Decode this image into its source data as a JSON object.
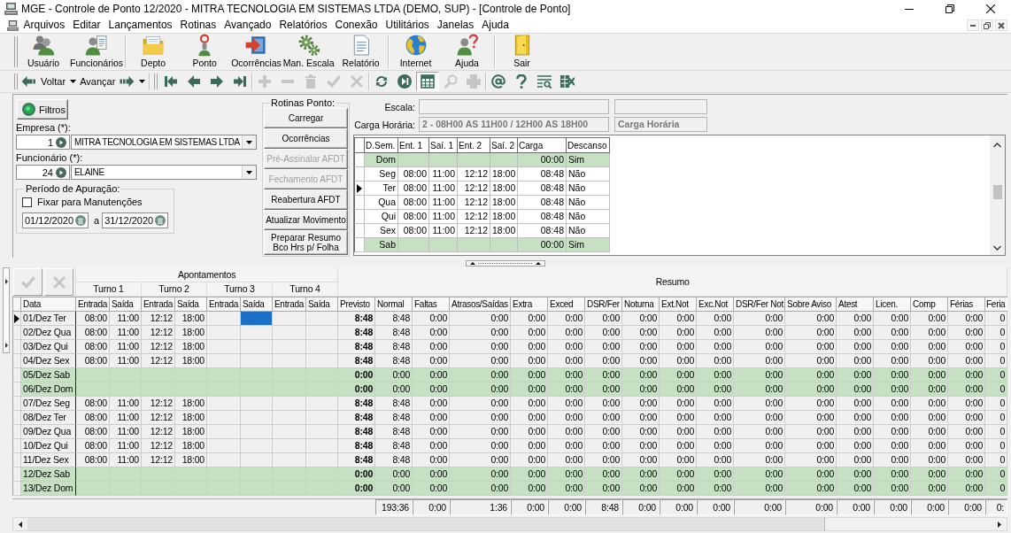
{
  "window": {
    "title": "MGE - Controle de Ponto 12/2020 - MITRA TECNOLOGIA EM SISTEMAS LTDA (DEMO, SUP) - [Controle de Ponto]"
  },
  "menu": [
    "Arquivos",
    "Editar",
    "Lançamentos",
    "Rotinas",
    "Avançado",
    "Relatórios",
    "Conexão",
    "Utilitários",
    "Janelas",
    "Ajuda"
  ],
  "toolbar": [
    [
      {
        "label": "Usuário"
      },
      {
        "label": "Funcionários"
      }
    ],
    [
      {
        "label": "Depto"
      },
      {
        "label": "Ponto"
      },
      {
        "label": "Ocorrências"
      },
      {
        "label": "Man. Escala"
      },
      {
        "label": "Relatório"
      }
    ],
    [
      {
        "label": "Internet"
      },
      {
        "label": "Ajuda"
      }
    ],
    [
      {
        "label": "Sair"
      }
    ]
  ],
  "navigation": {
    "back": "Voltar",
    "forward": "Avançar"
  },
  "tool_groups": [
    [
      {
        "disabled": false,
        "pressed": false
      },
      {
        "disabled": false,
        "pressed": false
      },
      {
        "disabled": false,
        "pressed": false
      },
      {
        "disabled": false,
        "pressed": false
      }
    ],
    [
      {
        "disabled": true,
        "pressed": false
      },
      {
        "disabled": true,
        "pressed": false
      },
      {
        "disabled": true,
        "pressed": false
      },
      {
        "disabled": true,
        "pressed": false
      },
      {
        "disabled": true,
        "pressed": false
      }
    ],
    [
      {
        "disabled": false,
        "pressed": false
      },
      {
        "disabled": false,
        "pressed": false
      },
      {
        "disabled": false,
        "pressed": true
      },
      {
        "disabled": true,
        "pressed": false
      },
      {
        "disabled": true,
        "pressed": false
      }
    ],
    [
      {
        "disabled": false,
        "pressed": false
      },
      {
        "disabled": false,
        "pressed": false
      },
      {
        "disabled": false,
        "pressed": false
      },
      {
        "disabled": false,
        "pressed": false
      }
    ]
  ],
  "filters": {
    "button": "Filtros",
    "company": {
      "label": "Empresa (*):",
      "code": "1",
      "name": "MITRA TECNOLOGIA EM SISTEMAS LTDA"
    },
    "employee": {
      "label": "Funcionário (*):",
      "code": "24",
      "name": "ELAINE"
    },
    "period": {
      "title": "Período de Apuração:",
      "fixed": {
        "label": "Fixar para Manutenções",
        "checked": false
      },
      "start": "01/12/2020",
      "to": "a",
      "end": "31/12/2020"
    }
  },
  "routines": {
    "title": "Rotinas Ponto:",
    "buttons": [
      {
        "label": "Carregar",
        "disabled": false
      },
      {
        "label": "Ocorrências",
        "disabled": false
      },
      {
        "label": "Pré-Assinalar AFDT",
        "disabled": true
      },
      {
        "label": "Fechamento AFDT",
        "disabled": true
      },
      {
        "label": "Reabertura AFDT",
        "disabled": false
      },
      {
        "label": "Atualizar Movimento",
        "disabled": false
      },
      {
        "label": "Preparar Resumo Bco Hrs p/ Folha",
        "disabled": false
      }
    ]
  },
  "schedule": {
    "scale_label": "Escala:",
    "workload_label": "Carga Horária:",
    "workload": "2 - 08H00 AS 11H00 / 12H00 AS 18H00",
    "workload_caption": "Carga Horária",
    "columns": [
      "D.Sem.",
      "Ent. 1",
      "Saí. 1",
      "Ent. 2",
      "Saí. 2",
      "Carga",
      "Descanso"
    ],
    "rows": [
      {
        "day": "Dom",
        "load": "00:00",
        "rest": "Sim",
        "rest_day": true,
        "selected": false
      },
      {
        "day": "Seg",
        "times": [
          "08:00",
          "11:00",
          "12:12",
          "18:00"
        ],
        "load": "08:48",
        "rest": "Não",
        "rest_day": false,
        "selected": false
      },
      {
        "day": "Ter",
        "times": [
          "08:00",
          "11:00",
          "12:12",
          "18:00"
        ],
        "load": "08:48",
        "rest": "Não",
        "rest_day": false,
        "selected": true
      },
      {
        "day": "Qua",
        "times": [
          "08:00",
          "11:00",
          "12:12",
          "18:00"
        ],
        "load": "08:48",
        "rest": "Não",
        "rest_day": false,
        "selected": false
      },
      {
        "day": "Qui",
        "times": [
          "08:00",
          "11:00",
          "12:12",
          "18:00"
        ],
        "load": "08:48",
        "rest": "Não",
        "rest_day": false,
        "selected": false
      },
      {
        "day": "Sex",
        "times": [
          "08:00",
          "11:00",
          "12:12",
          "18:00"
        ],
        "load": "08:48",
        "rest": "Não",
        "rest_day": false,
        "selected": false
      },
      {
        "day": "Sab",
        "load": "00:00",
        "rest": "Sim",
        "rest_day": true,
        "selected": false
      }
    ]
  },
  "grid": {
    "actions": [
      {
        "disabled": true
      },
      {
        "disabled": true
      }
    ],
    "group_title": "Apontamentos",
    "shifts": [
      "Turno 1",
      "Turno 2",
      "Turno 3",
      "Turno 4"
    ],
    "summary_title": "Resumo",
    "columns": [
      {
        "label": "Data",
        "selected": false
      },
      {
        "label": "Entrada",
        "selected": false
      },
      {
        "label": "Saída",
        "selected": false
      },
      {
        "label": "Entrada",
        "selected": false
      },
      {
        "label": "Saída",
        "selected": false
      },
      {
        "label": "Entrada",
        "selected": false
      },
      {
        "label": "Saída",
        "selected": true
      },
      {
        "label": "Entrada",
        "selected": false
      },
      {
        "label": "Saída",
        "selected": false
      },
      {
        "label": "Previsto",
        "selected": false
      },
      {
        "label": "Normal",
        "selected": false
      },
      {
        "label": "Faltas",
        "selected": false
      },
      {
        "label": "Atrasos/Saídas",
        "selected": false
      },
      {
        "label": "Extra",
        "selected": false
      },
      {
        "label": "Exced",
        "selected": false
      },
      {
        "label": "DSR/Fer",
        "selected": false
      },
      {
        "label": "Noturna",
        "selected": false
      },
      {
        "label": "Ext.Not",
        "selected": false
      },
      {
        "label": "Exc.Not",
        "selected": false
      },
      {
        "label": "DSR/Fer Not",
        "selected": false
      },
      {
        "label": "Sobre Aviso",
        "selected": false
      },
      {
        "label": "Atest",
        "selected": false
      },
      {
        "label": "Licen.",
        "selected": false
      },
      {
        "label": "Comp",
        "selected": false
      },
      {
        "label": "Férias",
        "selected": false
      },
      {
        "label": "Feria",
        "selected": false
      }
    ],
    "rows": [
      {
        "date": "01/Dez Ter",
        "punches": [
          "08:00",
          "11:00",
          "12:12",
          "18:00"
        ],
        "summary": [
          "8:48",
          "8:48",
          "0:00",
          "0:00",
          "0:00",
          "0:00",
          "0:00",
          "0:00",
          "0:00",
          "0:00",
          "0:00",
          "0:00",
          "0:00",
          "0:00",
          "0:00",
          "0:00",
          "0"
        ],
        "rest_day": false,
        "selected": true
      },
      {
        "date": "02/Dez Qua",
        "punches": [
          "08:00",
          "11:00",
          "12:12",
          "18:00"
        ],
        "summary": [
          "8:48",
          "8:48",
          "0:00",
          "0:00",
          "0:00",
          "0:00",
          "0:00",
          "0:00",
          "0:00",
          "0:00",
          "0:00",
          "0:00",
          "0:00",
          "0:00",
          "0:00",
          "0:00",
          "0"
        ],
        "rest_day": false,
        "selected": false
      },
      {
        "date": "03/Dez Qui",
        "punches": [
          "08:00",
          "11:00",
          "12:12",
          "18:00"
        ],
        "summary": [
          "8:48",
          "8:48",
          "0:00",
          "0:00",
          "0:00",
          "0:00",
          "0:00",
          "0:00",
          "0:00",
          "0:00",
          "0:00",
          "0:00",
          "0:00",
          "0:00",
          "0:00",
          "0:00",
          "0"
        ],
        "rest_day": false,
        "selected": false
      },
      {
        "date": "04/Dez Sex",
        "punches": [
          "08:00",
          "11:00",
          "12:12",
          "18:00"
        ],
        "summary": [
          "8:48",
          "8:48",
          "0:00",
          "0:00",
          "0:00",
          "0:00",
          "0:00",
          "0:00",
          "0:00",
          "0:00",
          "0:00",
          "0:00",
          "0:00",
          "0:00",
          "0:00",
          "0:00",
          "0"
        ],
        "rest_day": false,
        "selected": false
      },
      {
        "date": "05/Dez Sab",
        "summary": [
          "0:00",
          "0:00",
          "0:00",
          "0:00",
          "0:00",
          "0:00",
          "0:00",
          "0:00",
          "0:00",
          "0:00",
          "0:00",
          "0:00",
          "0:00",
          "0:00",
          "0:00",
          "0:00",
          "0"
        ],
        "rest_day": true,
        "selected": false
      },
      {
        "date": "06/Dez Dom",
        "summary": [
          "0:00",
          "0:00",
          "0:00",
          "0:00",
          "0:00",
          "0:00",
          "0:00",
          "0:00",
          "0:00",
          "0:00",
          "0:00",
          "0:00",
          "0:00",
          "0:00",
          "0:00",
          "0:00",
          "0"
        ],
        "rest_day": true,
        "selected": false
      },
      {
        "date": "07/Dez Seg",
        "punches": [
          "08:00",
          "11:00",
          "12:12",
          "18:00"
        ],
        "summary": [
          "8:48",
          "8:48",
          "0:00",
          "0:00",
          "0:00",
          "0:00",
          "0:00",
          "0:00",
          "0:00",
          "0:00",
          "0:00",
          "0:00",
          "0:00",
          "0:00",
          "0:00",
          "0:00",
          "0"
        ],
        "rest_day": false,
        "selected": false
      },
      {
        "date": "08/Dez Ter",
        "punches": [
          "08:00",
          "11:00",
          "12:12",
          "18:00"
        ],
        "summary": [
          "8:48",
          "8:48",
          "0:00",
          "0:00",
          "0:00",
          "0:00",
          "0:00",
          "0:00",
          "0:00",
          "0:00",
          "0:00",
          "0:00",
          "0:00",
          "0:00",
          "0:00",
          "0:00",
          "0"
        ],
        "rest_day": false,
        "selected": false
      },
      {
        "date": "09/Dez Qua",
        "punches": [
          "08:00",
          "11:00",
          "12:12",
          "18:00"
        ],
        "summary": [
          "8:48",
          "8:48",
          "0:00",
          "0:00",
          "0:00",
          "0:00",
          "0:00",
          "0:00",
          "0:00",
          "0:00",
          "0:00",
          "0:00",
          "0:00",
          "0:00",
          "0:00",
          "0:00",
          "0"
        ],
        "rest_day": false,
        "selected": false
      },
      {
        "date": "10/Dez Qui",
        "punches": [
          "08:00",
          "11:00",
          "12:12",
          "18:00"
        ],
        "summary": [
          "8:48",
          "8:48",
          "0:00",
          "0:00",
          "0:00",
          "0:00",
          "0:00",
          "0:00",
          "0:00",
          "0:00",
          "0:00",
          "0:00",
          "0:00",
          "0:00",
          "0:00",
          "0:00",
          "0"
        ],
        "rest_day": false,
        "selected": false
      },
      {
        "date": "11/Dez Sex",
        "punches": [
          "08:00",
          "11:00",
          "12:12",
          "18:00"
        ],
        "summary": [
          "8:48",
          "8:48",
          "0:00",
          "0:00",
          "0:00",
          "0:00",
          "0:00",
          "0:00",
          "0:00",
          "0:00",
          "0:00",
          "0:00",
          "0:00",
          "0:00",
          "0:00",
          "0:00",
          "0"
        ],
        "rest_day": false,
        "selected": false
      },
      {
        "date": "12/Dez Sab",
        "summary": [
          "0:00",
          "0:00",
          "0:00",
          "0:00",
          "0:00",
          "0:00",
          "0:00",
          "0:00",
          "0:00",
          "0:00",
          "0:00",
          "0:00",
          "0:00",
          "0:00",
          "0:00",
          "0:00",
          "0"
        ],
        "rest_day": true,
        "selected": false
      },
      {
        "date": "13/Dez Dom",
        "summary": [
          "0:00",
          "0:00",
          "0:00",
          "0:00",
          "0:00",
          "0:00",
          "0:00",
          "0:00",
          "0:00",
          "0:00",
          "0:00",
          "0:00",
          "0:00",
          "0:00",
          "0:00",
          "0:00",
          "0"
        ],
        "rest_day": true,
        "selected": false
      }
    ],
    "totals": [
      "193:36",
      "0:00",
      "1:36",
      "0:00",
      "0:00",
      "8:48",
      "0:00",
      "0:00",
      "0:00",
      "0:00",
      "0:00",
      "0:00",
      "0:00",
      "0:00",
      "0:00",
      "0:"
    ]
  }
}
